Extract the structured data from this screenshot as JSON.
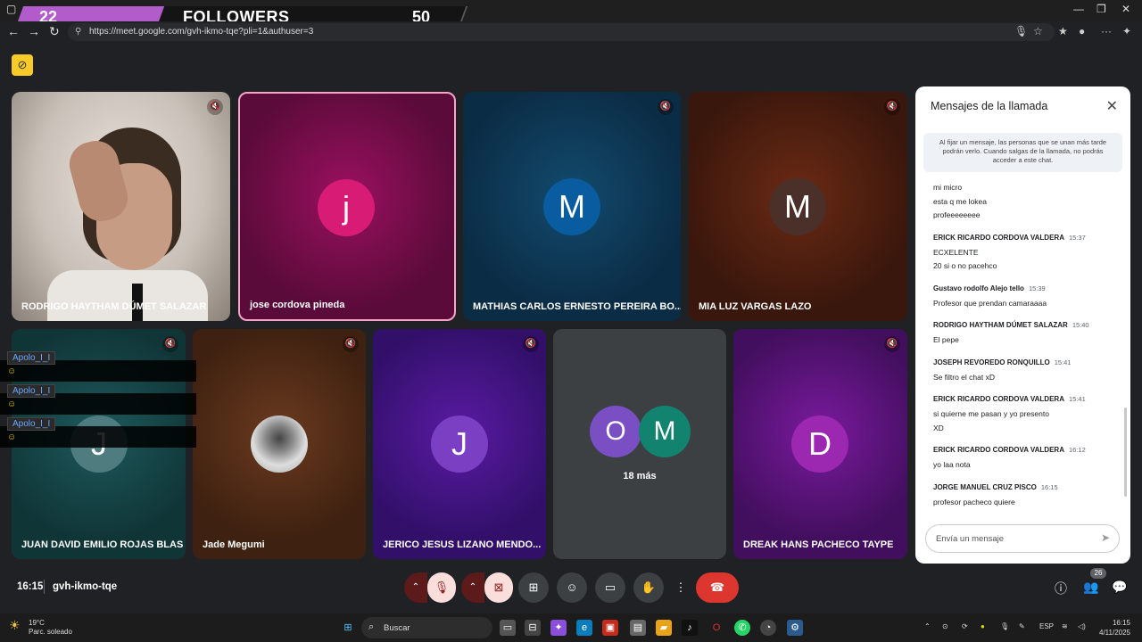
{
  "overlay": {
    "followers_count": "22",
    "followers_label": "FOLLOWERS",
    "followers_goal": "50"
  },
  "browser": {
    "url": "https://meet.google.com/gvh-ikmo-tqe?pli=1&authuser=3"
  },
  "tiles": [
    {
      "name": "RODRIGO HAYTHAM DÚMET SALAZAR"
    },
    {
      "name": "jose cordova pineda",
      "initial": "j",
      "color": "#d81b75"
    },
    {
      "name": "MATHIAS CARLOS ERNESTO PEREIRA BO...",
      "initial": "M",
      "color": "#0a5ca0"
    },
    {
      "name": "MIA LUZ VARGAS LAZO",
      "initial": "M",
      "color": "#4a3028"
    },
    {
      "name": "JUAN DAVID EMILIO ROJAS BLAS",
      "initial": "J",
      "color": "#4f7c7e"
    },
    {
      "name": "Jade Megumi"
    },
    {
      "name": "JERICO JESUS LIZANO MENDO...",
      "initial": "J",
      "color": "#7b3fc4"
    },
    {
      "name": "",
      "initial_a": "O",
      "initial_b": "M",
      "more": "18 más"
    },
    {
      "name": "DREAK HANS PACHECO TAYPE",
      "initial": "D",
      "color": "#9c27b0"
    }
  ],
  "stream_chat": [
    {
      "user": "Apolo_I_I",
      "emoji": "☺"
    },
    {
      "user": "Apolo_I_I",
      "emoji": "☺"
    },
    {
      "user": "Apolo_I_I",
      "emoji": "☺"
    }
  ],
  "chat": {
    "title": "Mensajes de la llamada",
    "notice": "Al fijar un mensaje, las personas que se unan más tarde podrán verlo. Cuando salgas de la llamada, no podrás acceder a este chat.",
    "lines": [
      {
        "kind": "text",
        "text": "mi micro"
      },
      {
        "kind": "text",
        "text": "esta q me lokea"
      },
      {
        "kind": "text",
        "text": "profeeeeeeee"
      },
      {
        "kind": "sender",
        "text": "ERICK RICARDO CORDOVA VALDERA",
        "time": "15:37"
      },
      {
        "kind": "text",
        "text": "ECXELENTE"
      },
      {
        "kind": "text",
        "text": "20 si o no pacehco"
      },
      {
        "kind": "sender",
        "text": "Gustavo rodolfo Alejo tello",
        "time": "15:39"
      },
      {
        "kind": "text",
        "text": "Profesor que prendan camaraaaa"
      },
      {
        "kind": "sender",
        "text": "RODRIGO HAYTHAM DÚMET SALAZAR",
        "time": "15:40"
      },
      {
        "kind": "text",
        "text": "El pepe"
      },
      {
        "kind": "sender",
        "text": "JOSEPH REVOREDO RONQUILLO",
        "time": "15:41"
      },
      {
        "kind": "text",
        "text": "Se filtro el chat xD"
      },
      {
        "kind": "sender",
        "text": "ERICK RICARDO CORDOVA VALDERA",
        "time": "15:41"
      },
      {
        "kind": "text",
        "text": "si quierne me pasan y yo presento"
      },
      {
        "kind": "text",
        "text": "XD"
      },
      {
        "kind": "sender",
        "text": "ERICK RICARDO CORDOVA VALDERA",
        "time": "16:12"
      },
      {
        "kind": "text",
        "text": "yo laa nota"
      },
      {
        "kind": "sender",
        "text": "JORGE MANUEL CRUZ PISCO",
        "time": "16:15"
      },
      {
        "kind": "text",
        "text": "profesor  pacheco quiere"
      }
    ],
    "input_placeholder": "Envía un mensaje"
  },
  "meeting": {
    "time": "16:15",
    "code": "gvh-ikmo-tqe",
    "participants": "26"
  },
  "taskbar": {
    "temp": "19°C",
    "weather": "Parc. soleado",
    "search_placeholder": "Buscar",
    "lang": "ESP",
    "time": "16:15",
    "date": "4/11/2025"
  }
}
